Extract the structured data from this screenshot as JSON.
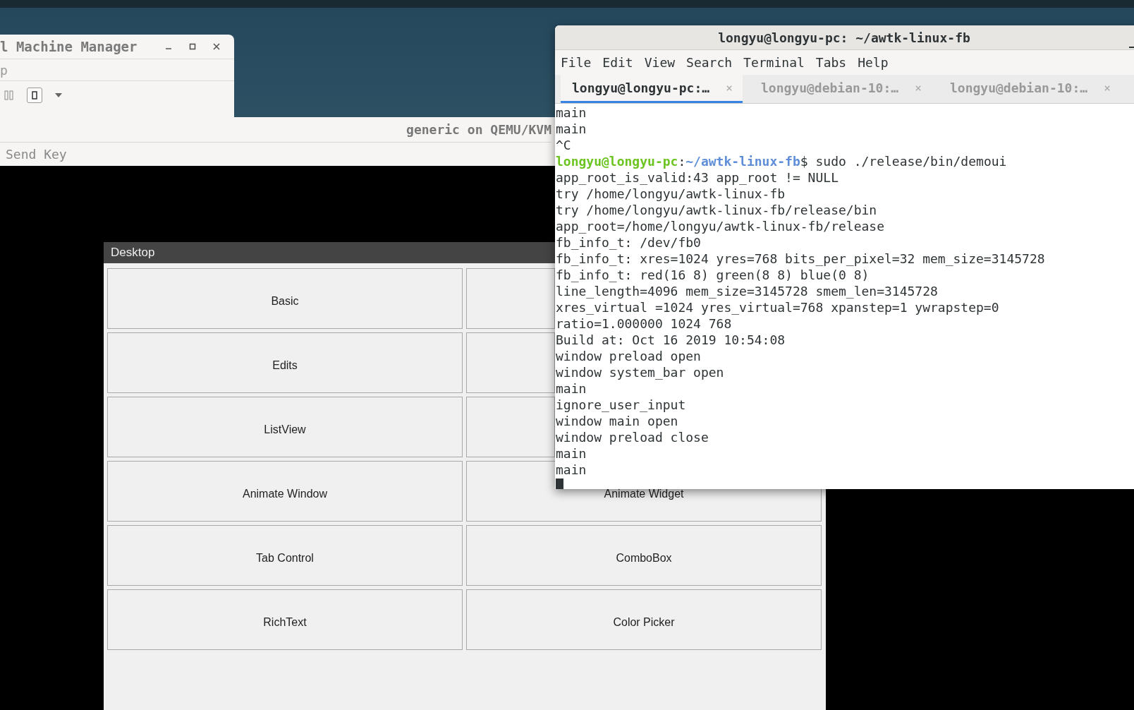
{
  "manager_window": {
    "title": "l Machine Manager",
    "menu": [
      "p"
    ]
  },
  "console_window": {
    "title": "generic on QEMU/KVM",
    "menu": [
      "Send Key"
    ]
  },
  "app_window": {
    "title": "Desktop",
    "buttons": [
      {
        "kind": "labeled",
        "label": "Basic"
      },
      {
        "kind": "blank"
      },
      {
        "kind": "labeled",
        "label": "Edits"
      },
      {
        "kind": "blank"
      },
      {
        "kind": "labeled",
        "label": "ListView"
      },
      {
        "kind": "blank"
      },
      {
        "kind": "labeled",
        "label": "Animate Window"
      },
      {
        "kind": "labeled",
        "label": "Animate Widget"
      },
      {
        "kind": "labeled",
        "label": "Tab Control"
      },
      {
        "kind": "labeled",
        "label": "ComboBox"
      },
      {
        "kind": "labeled",
        "label": "RichText"
      },
      {
        "kind": "labeled",
        "label": "Color Picker"
      }
    ]
  },
  "terminal": {
    "title": "longyu@longyu-pc: ~/awtk-linux-fb",
    "menu": [
      "File",
      "Edit",
      "View",
      "Search",
      "Terminal",
      "Tabs",
      "Help"
    ],
    "tabs": [
      {
        "label": "longyu@longyu-pc:…",
        "close": "×",
        "selected": true
      },
      {
        "label": "longyu@debian-10:…",
        "close": "×",
        "selected": false
      },
      {
        "label": "longyu@debian-10:…",
        "close": "×",
        "selected": false
      }
    ],
    "lines": [
      {
        "kind": "output",
        "text": "main"
      },
      {
        "kind": "output",
        "text": "main"
      },
      {
        "kind": "output",
        "text": "^C"
      },
      {
        "kind": "prompt",
        "user": "longyu@longyu-pc",
        "separator": ":",
        "path": "~/awtk-linux-fb",
        "command": "$ sudo ./release/bin/demoui"
      },
      {
        "kind": "output",
        "text": "app_root_is_valid:43 app_root != NULL"
      },
      {
        "kind": "output",
        "text": "try /home/longyu/awtk-linux-fb"
      },
      {
        "kind": "output",
        "text": "try /home/longyu/awtk-linux-fb/release/bin"
      },
      {
        "kind": "output",
        "text": "app_root=/home/longyu/awtk-linux-fb/release"
      },
      {
        "kind": "output",
        "text": "fb_info_t: /dev/fb0"
      },
      {
        "kind": "output",
        "text": "fb_info_t: xres=1024 yres=768 bits_per_pixel=32 mem_size=3145728"
      },
      {
        "kind": "output",
        "text": "fb_info_t: red(16 8) green(8 8) blue(0 8)"
      },
      {
        "kind": "output",
        "text": "line_length=4096 mem_size=3145728 smem_len=3145728"
      },
      {
        "kind": "output",
        "text": "xres_virtual =1024 yres_virtual=768 xpanstep=1 ywrapstep=0"
      },
      {
        "kind": "output",
        "text": "ratio=1.000000 1024 768"
      },
      {
        "kind": "output",
        "text": "Build at: Oct 16 2019 10:54:08"
      },
      {
        "kind": "output",
        "text": "window preload open"
      },
      {
        "kind": "output",
        "text": "window system_bar open"
      },
      {
        "kind": "output",
        "text": "main"
      },
      {
        "kind": "output",
        "text": "ignore_user_input"
      },
      {
        "kind": "output",
        "text": "window main open"
      },
      {
        "kind": "output",
        "text": "window preload close"
      },
      {
        "kind": "output",
        "text": "main"
      },
      {
        "kind": "output",
        "text": "main"
      }
    ]
  }
}
